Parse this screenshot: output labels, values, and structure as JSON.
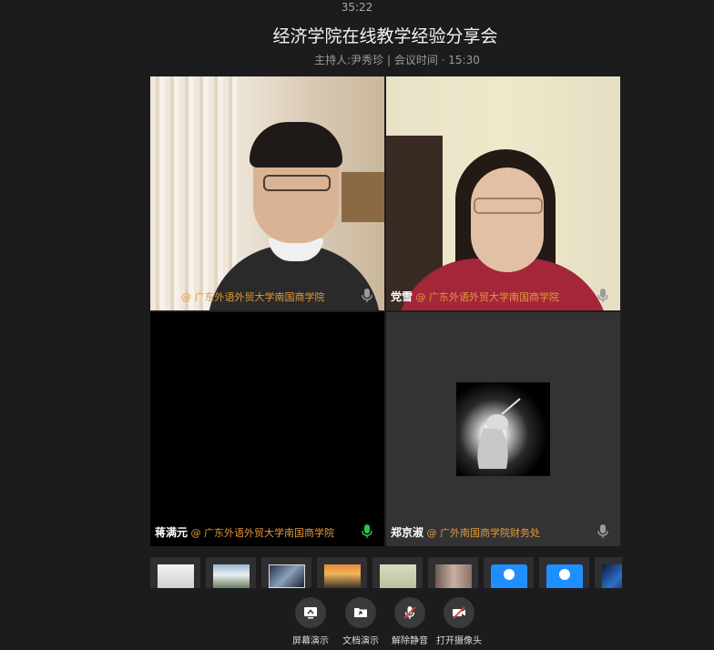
{
  "header": {
    "timer": "35:22",
    "title": "经济学院在线教学经验分享会",
    "subtitle": "主持人:尹秀珍 | 会议时间 · 15:30"
  },
  "tiles": [
    {
      "name": "",
      "org": "@ 广东外语外贸大学南国商学院",
      "mic_icon": "mic-icon",
      "mic_color": "#9a9a9a"
    },
    {
      "name": "党雪",
      "org": "@ 广东外语外贸大学南国商学院",
      "mic_icon": "mic-icon",
      "mic_color": "#9a9a9a"
    },
    {
      "name": "蒋满元",
      "org": "@ 广东外语外贸大学南国商学院",
      "mic_icon": "mic-active-icon",
      "mic_color": "#2ec24a"
    },
    {
      "name": "郑京淑",
      "org": "@ 广外南国商学院财务处",
      "mic_icon": "mic-icon",
      "mic_color": "#9a9a9a"
    }
  ],
  "toolbar": {
    "screen_share": "屏幕演示",
    "doc_share": "文档演示",
    "unmute": "解除静音",
    "camera": "打开摄像头"
  },
  "colors": {
    "background": "#1c1c1e",
    "org_text": "#e39a3c",
    "mute_red": "#e03a3a"
  }
}
